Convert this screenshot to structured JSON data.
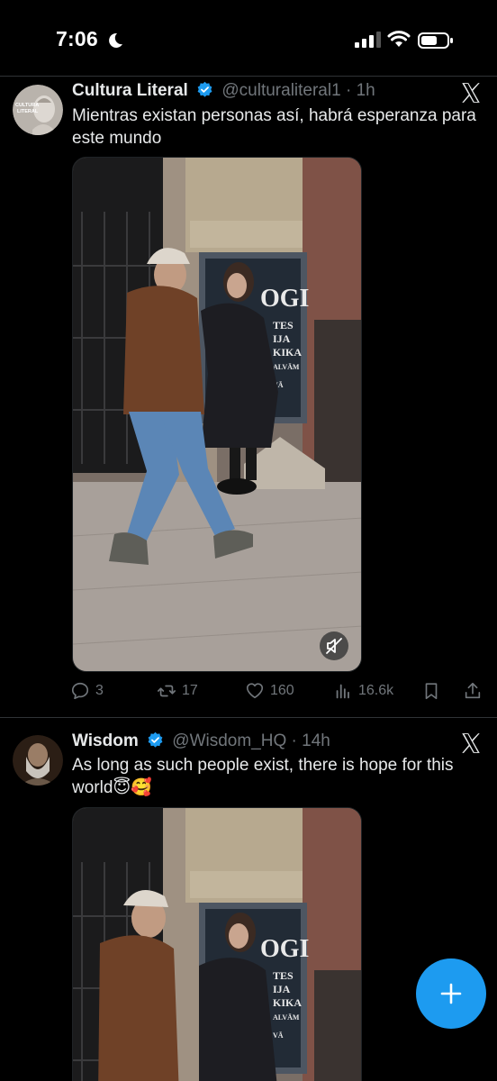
{
  "status_bar": {
    "time": "7:06",
    "icons": [
      "moon-icon",
      "cellular-signal-icon",
      "wifi-icon",
      "battery-icon"
    ]
  },
  "tweets": [
    {
      "author": {
        "name": "Cultura Literal",
        "handle": "@culturaliteral1",
        "avatar_text": "CULTURA LITERAL"
      },
      "separator": "·",
      "time": "1h",
      "text": "Mientras existan personas así, habrá esperanza para este mundo",
      "media": {
        "type": "video",
        "sign_text": "OGI",
        "sign_lines": [
          "TES",
          "IJA",
          "KIKA",
          "ALVĀM",
          "VĀ"
        ]
      },
      "actions": {
        "replies": "3",
        "reposts": "17",
        "likes": "160",
        "views": "16.6k"
      }
    },
    {
      "author": {
        "name": "Wisdom",
        "handle": "@Wisdom_HQ"
      },
      "separator": "·",
      "time": "14h",
      "text": "As long as such people exist, there is hope for this world😇🥰",
      "media": {
        "type": "video",
        "sign_text": "OGI",
        "sign_lines": [
          "TES",
          "IJA",
          "KIKA",
          "ALVĀM",
          "VĀ"
        ]
      }
    }
  ],
  "colors": {
    "background": "#000000",
    "text": "#e7e9ea",
    "secondary": "#71767b",
    "accent": "#1d9bf0"
  }
}
